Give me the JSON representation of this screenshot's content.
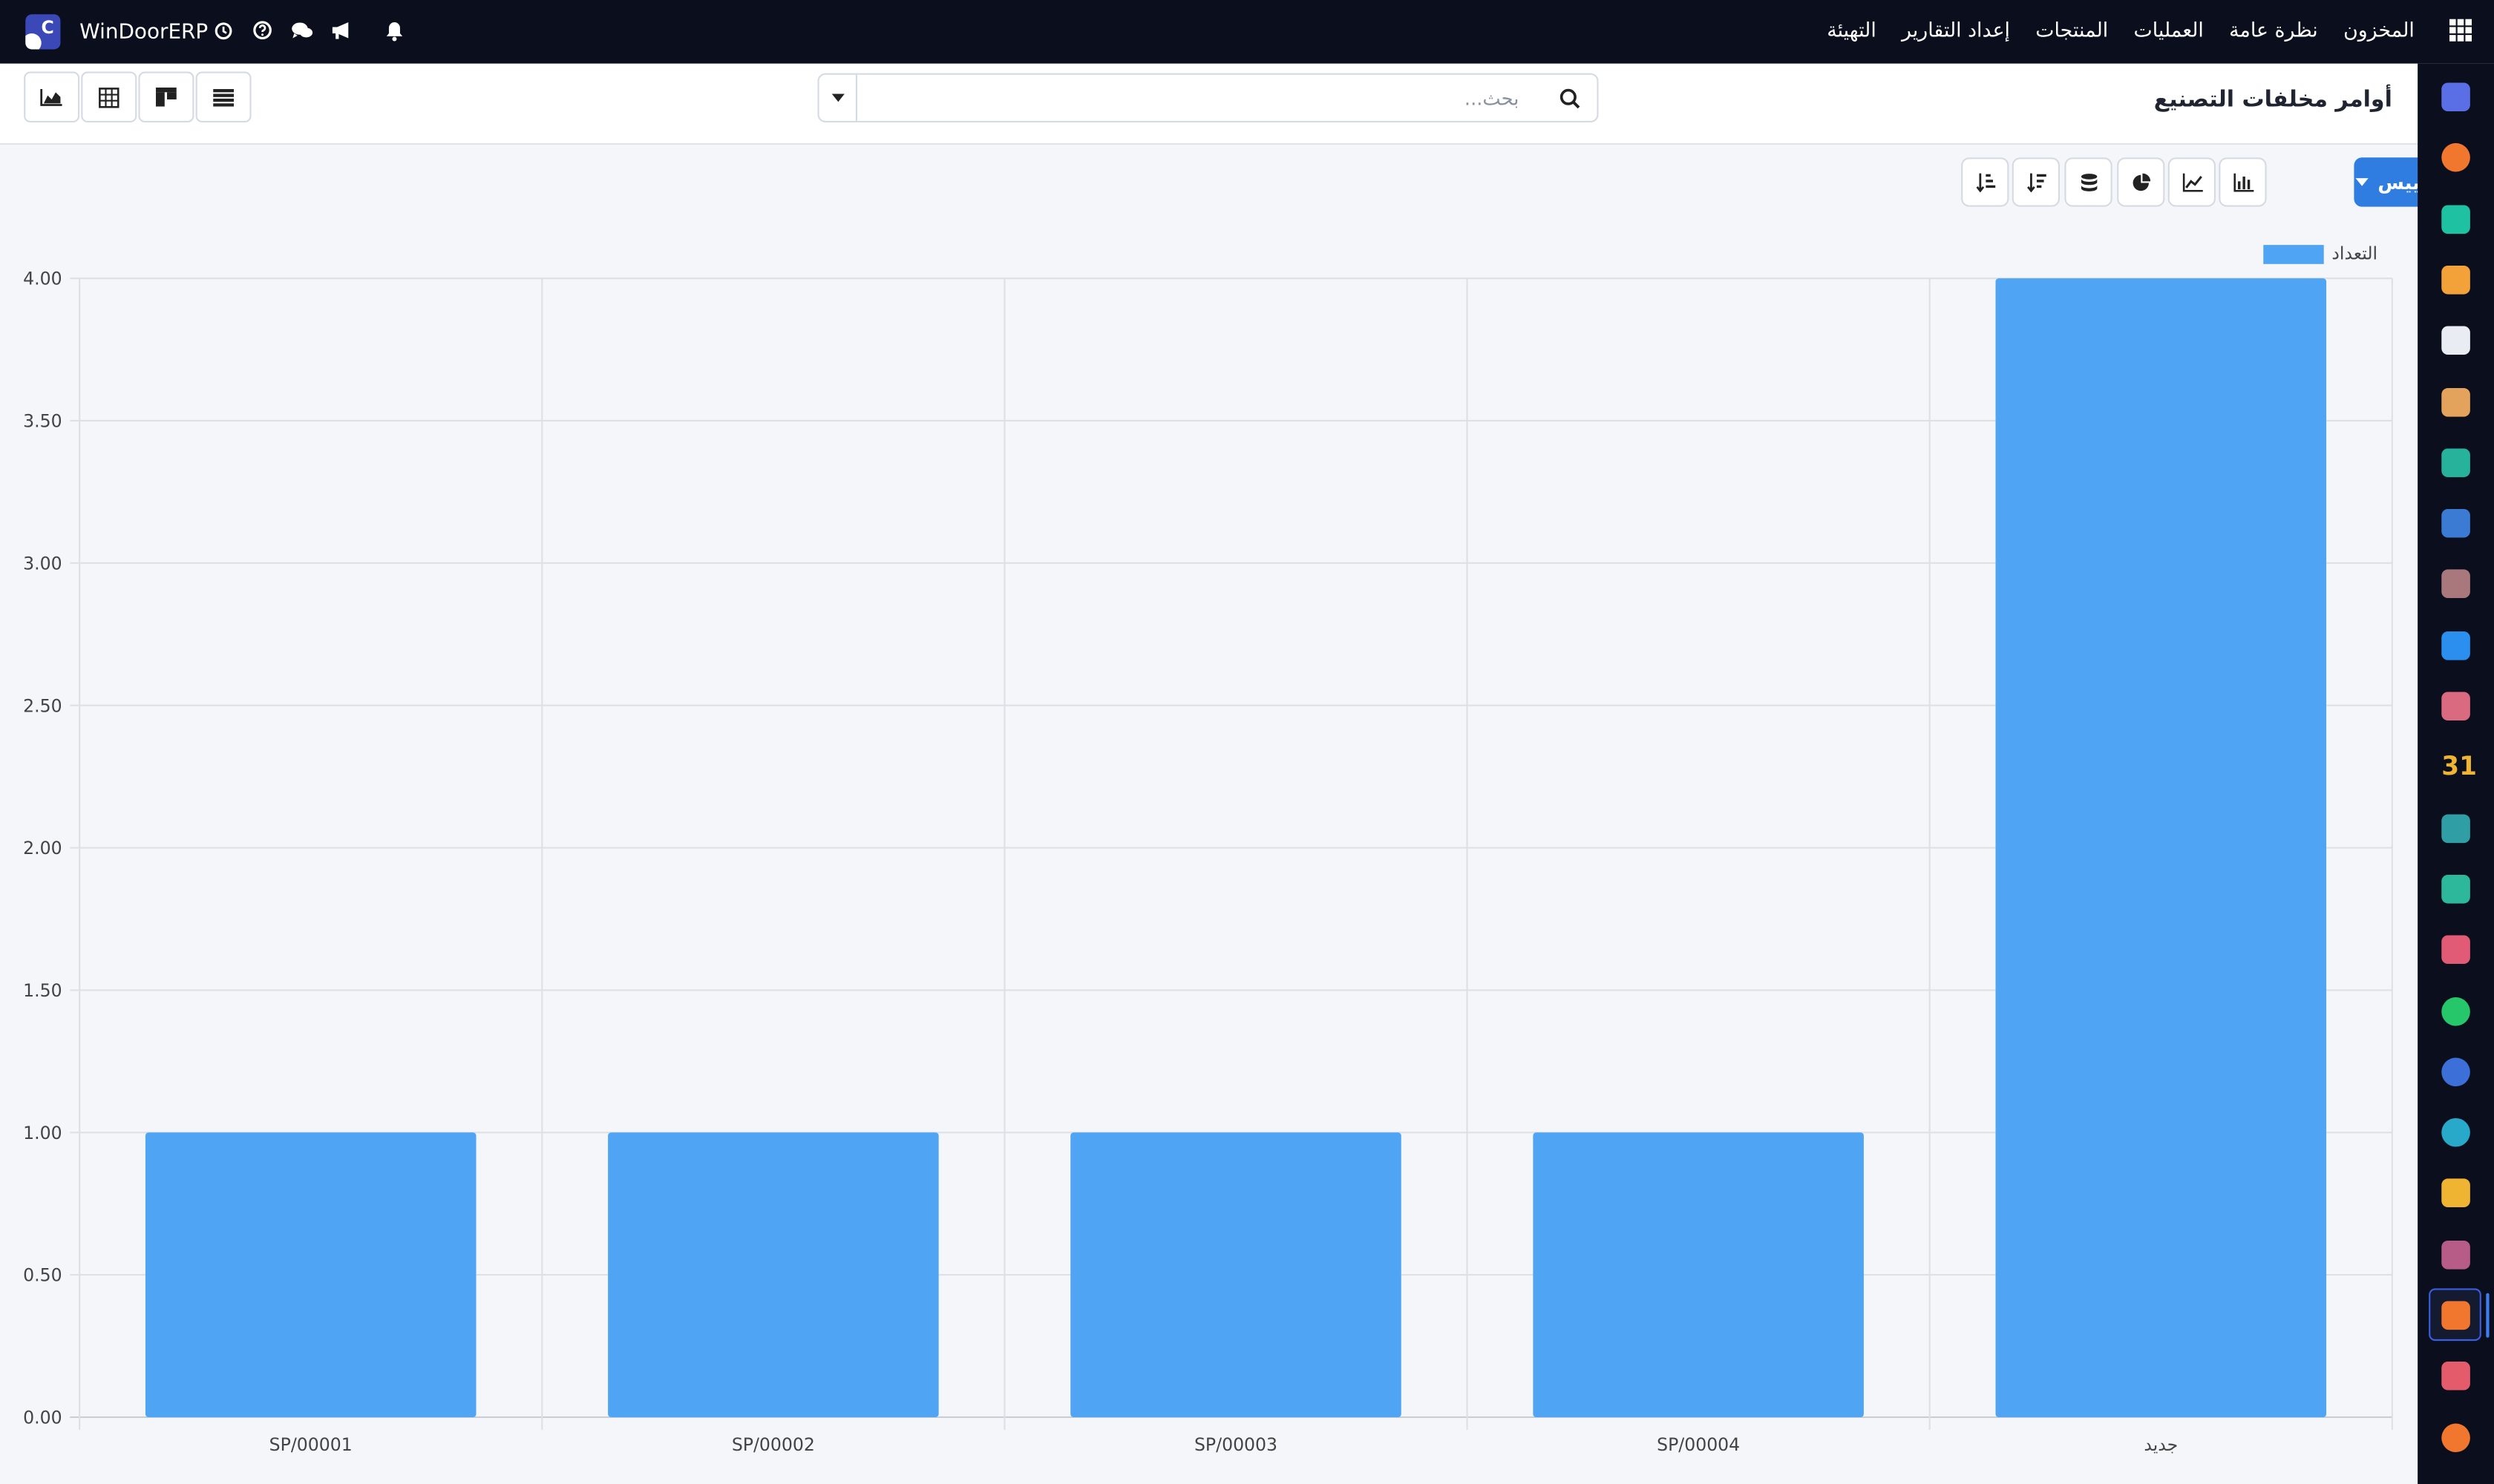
{
  "app": {
    "brand_name": "WinDoorERP",
    "logo_letter": "C"
  },
  "topbar": {
    "menu": [
      "المخزون",
      "نظرة عامة",
      "العمليات",
      "المنتجات",
      "إعداد التقارير",
      "التهيئة"
    ],
    "icons": [
      "clock-icon",
      "help-icon",
      "chat-icon",
      "megaphone-icon",
      "bell-icon"
    ]
  },
  "control_panel": {
    "title": "أوامر مخلفات التصنيع",
    "search_placeholder": "بحث..."
  },
  "graph_toolbar": {
    "measures_label": "المقاييس"
  },
  "sidebar": {
    "apps": [
      {
        "icon": "mrp-icon",
        "color": "#5a6fe6"
      },
      {
        "icon": "discuss-icon",
        "color": "#f0772d"
      },
      {
        "icon": "sales-icon",
        "color": "#1fc1a3"
      },
      {
        "icon": "reporting-icon",
        "color": "#f3a23a"
      },
      {
        "icon": "inventory-box-icon",
        "color": "#e9ecf2"
      },
      {
        "icon": "contacts-icon",
        "color": "#e4a35d"
      },
      {
        "icon": "tasks-icon",
        "color": "#27b39b"
      },
      {
        "icon": "knowledge-icon",
        "color": "#3c7bd4"
      },
      {
        "icon": "package-icon",
        "color": "#a8787c"
      },
      {
        "icon": "invoicing-icon",
        "color": "#2b8ff0"
      },
      {
        "icon": "employees-icon",
        "color": "#d96a7f"
      },
      {
        "icon": "calendar-icon",
        "color": "#f0b433"
      },
      {
        "icon": "sign-icon",
        "color": "#2f9fa5"
      },
      {
        "icon": "contact-card-icon",
        "color": "#2db89b"
      },
      {
        "icon": "dashboard-icon",
        "color": "#e15b76"
      },
      {
        "icon": "whatsapp-icon",
        "color": "#26c66a"
      },
      {
        "icon": "timesheet-icon",
        "color": "#3c6fd8"
      },
      {
        "icon": "website-icon",
        "color": "#29a9c9"
      },
      {
        "icon": "telegram-icon",
        "color": "#f0b433"
      },
      {
        "icon": "accounting-icon",
        "color": "#b75b87"
      },
      {
        "icon": "manufacturing-icon",
        "color": "#f0772d"
      },
      {
        "icon": "piechart-app-icon",
        "color": "#e45c6b"
      },
      {
        "icon": "repair-icon",
        "color": "#f0772d"
      }
    ]
  },
  "chart_data": {
    "type": "bar",
    "categories": [
      "SP/00001",
      "SP/00002",
      "SP/00003",
      "SP/00004",
      "جديد"
    ],
    "series": [
      {
        "name": "التعداد",
        "values": [
          1,
          1,
          1,
          1,
          4
        ]
      }
    ],
    "ylim": [
      0,
      4
    ],
    "yticks": [
      "0.00",
      "0.50",
      "1.00",
      "1.50",
      "2.00",
      "2.50",
      "3.00",
      "3.50",
      "4.00"
    ],
    "grid": true,
    "legend_placement": "top-right",
    "bar_color": "#4fa5f3"
  }
}
